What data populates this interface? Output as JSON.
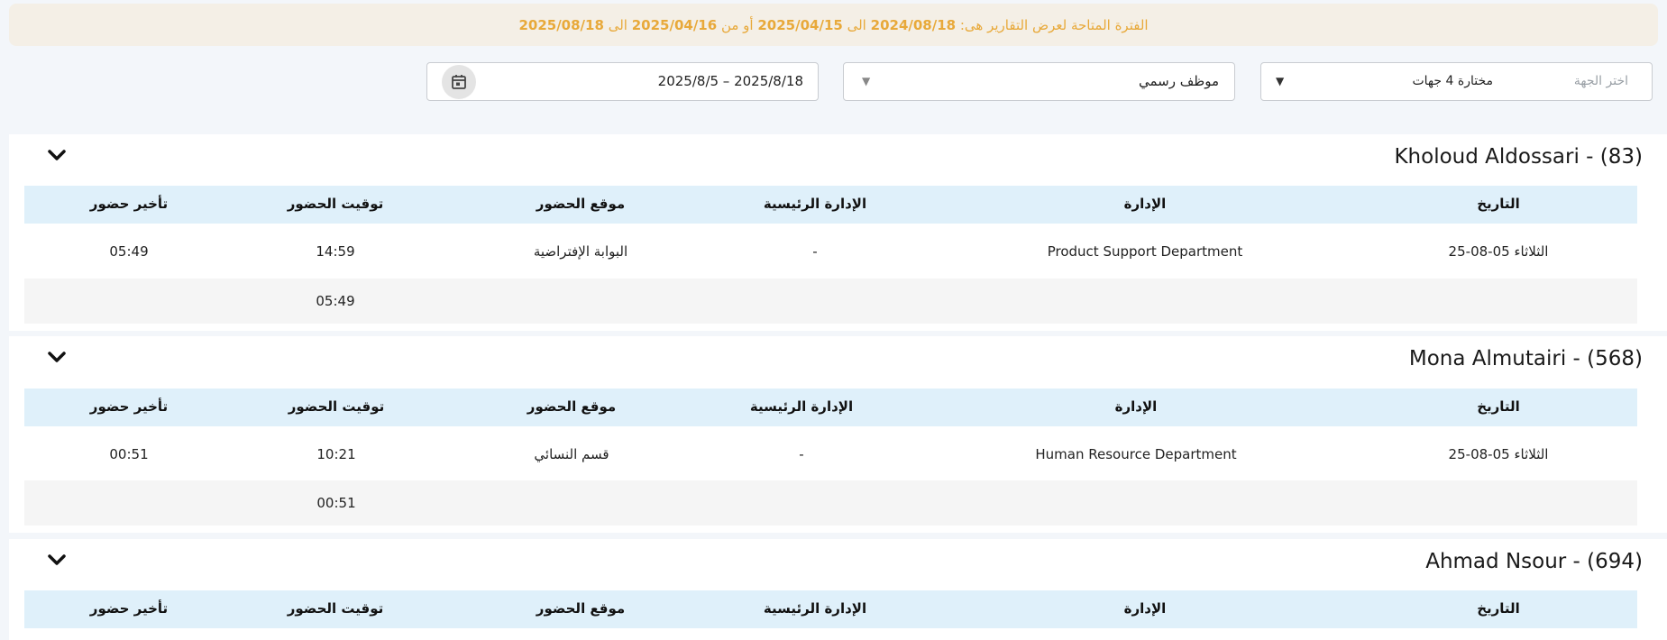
{
  "banner": {
    "prefix": "الفترة المتاحة لعرض التقارير هى:",
    "d1": "2024/08/18",
    "sep1": "الى",
    "d2": "2025/04/15",
    "sep2": "أو من",
    "d3": "2025/04/16",
    "sep3": "الى",
    "d4": "2025/08/18"
  },
  "filters": {
    "entity": {
      "placeholder": "اختر الجهة",
      "value": "مختارة 4 جهات"
    },
    "employee_type": {
      "value": "موظف رسمي"
    },
    "date_range": {
      "value": "2025/8/5 – 2025/8/18"
    }
  },
  "table_headers": {
    "date": "التاريخ",
    "department": "الإدارة",
    "main_department": "الإدارة الرئيسية",
    "location": "موقع الحضور",
    "time": "توقيت الحضور",
    "delay": "تأخير حضور"
  },
  "employees": [
    {
      "title": "Kholoud Aldossari - (83)",
      "row": {
        "date": "الثلاثاء 05-08-25",
        "department": "Product Support Department",
        "main_department": "-",
        "location": "البوابة الإفتراضية",
        "time": "14:59",
        "delay": "05:49"
      },
      "total_time": "05:49"
    },
    {
      "title": "Mona Almutairi - (568)",
      "row": {
        "date": "الثلاثاء 05-08-25",
        "department": "Human Resource Department",
        "main_department": "-",
        "location": "قسم النسائي",
        "time": "10:21",
        "delay": "00:51"
      },
      "total_time": "00:51"
    },
    {
      "title": "Ahmad Nsour - (694)"
    }
  ]
}
